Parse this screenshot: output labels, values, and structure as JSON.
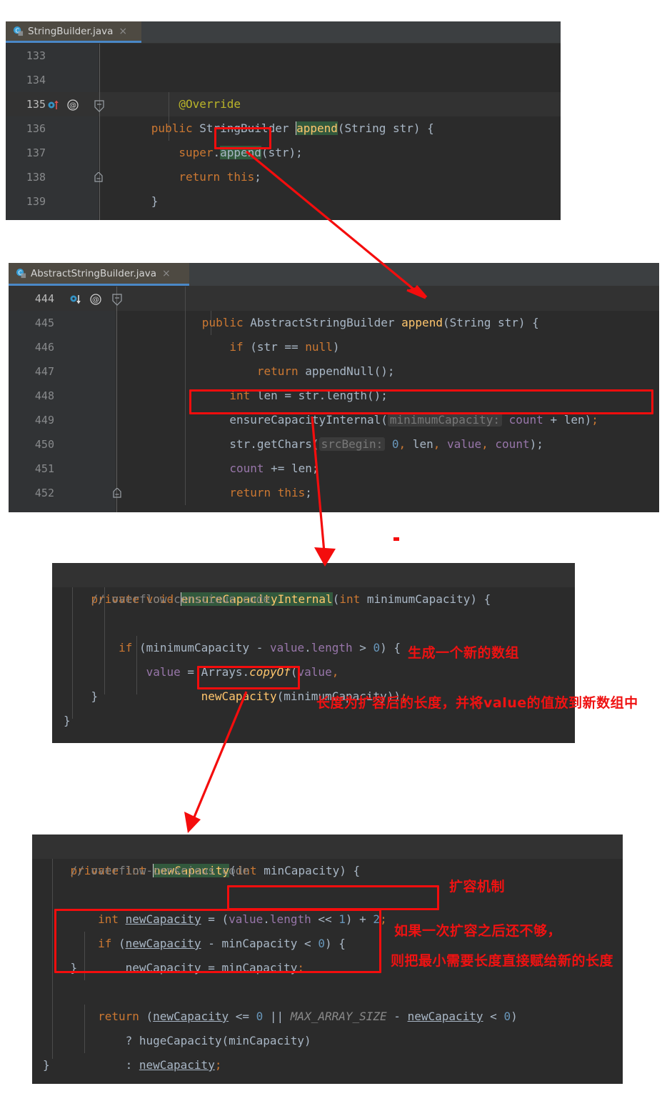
{
  "meta": {
    "accent_blue": "#4a88c7",
    "annotation_red": "#ef1212",
    "editor_bg": "#2b2b2b",
    "gutter_bg": "#313335",
    "tab_bg": "#4e4a42"
  },
  "panels": [
    {
      "id": "stringbuilder",
      "tab": {
        "label": "StringBuilder.java",
        "close": "×",
        "icon": "java-class-icon"
      },
      "lines": [
        {
          "num": "133",
          "text": ""
        },
        {
          "num": "134",
          "text": "    @Override"
        },
        {
          "num": "135",
          "text": "    public StringBuilder append(String str) {"
        },
        {
          "num": "136",
          "text": "        super.append(str);"
        },
        {
          "num": "137",
          "text": "        return this;"
        },
        {
          "num": "138",
          "text": "    }"
        },
        {
          "num": "139",
          "text": ""
        }
      ],
      "gutter_icons": {
        "line": "135",
        "override_marker": "overriding-method-icon",
        "at_marker": "annotation-icon",
        "fold": "fold-collapse-icon"
      }
    },
    {
      "id": "abstractstringbuilder",
      "tab": {
        "label": "AbstractStringBuilder.java",
        "close": "×",
        "icon": "java-class-icon"
      },
      "lines": [
        {
          "num": "444",
          "text": "    public AbstractStringBuilder append(String str) {"
        },
        {
          "num": "445",
          "text": "        if (str == null)"
        },
        {
          "num": "446",
          "text": "            return appendNull();"
        },
        {
          "num": "447",
          "text": "        int len = str.length();"
        },
        {
          "num": "448",
          "text": "        ensureCapacityInternal( minimumCapacity: count + len);"
        },
        {
          "num": "449",
          "text": "        str.getChars( srcBegin: 0, len, value, count);"
        },
        {
          "num": "450",
          "text": "        count += len;"
        },
        {
          "num": "451",
          "text": "        return this;"
        },
        {
          "num": "452",
          "text": "    }"
        }
      ],
      "param_hints": [
        "minimumCapacity:",
        "srcBegin:"
      ],
      "gutter_icons": {
        "line": "444",
        "implemented_marker": "implemented-method-icon",
        "at_marker": "annotation-icon",
        "fold": "fold-collapse-icon"
      }
    },
    {
      "id": "ensurecapacityinternal",
      "lines": [
        {
          "text": "private void ensureCapacityInternal(int minimumCapacity) {"
        },
        {
          "text": "    // overflow-conscious code"
        },
        {
          "text": "    if (minimumCapacity - value.length > 0) {"
        },
        {
          "text": "        value = Arrays.copyOf(value,"
        },
        {
          "text": "                newCapacity(minimumCapacity));"
        },
        {
          "text": "    }"
        },
        {
          "text": "}"
        }
      ]
    },
    {
      "id": "newcapacity",
      "lines": [
        {
          "text": "private int newCapacity(int minCapacity) {"
        },
        {
          "text": "    // overflow-conscious code"
        },
        {
          "text": "    int newCapacity = (value.length << 1) + 2;"
        },
        {
          "text": "    if (newCapacity - minCapacity < 0) {"
        },
        {
          "text": "        newCapacity = minCapacity;"
        },
        {
          "text": "    }"
        },
        {
          "text": "    return (newCapacity <= 0 || MAX_ARRAY_SIZE - newCapacity < 0)"
        },
        {
          "text": "        ? hugeCapacity(minCapacity)"
        },
        {
          "text": "        : newCapacity;"
        },
        {
          "text": "}"
        }
      ]
    }
  ],
  "annotations": [
    {
      "id": "note-new-array",
      "text": "生成一个新的数组"
    },
    {
      "id": "note-copy-value",
      "text": "长度为扩容后的长度，并将value的值放到新数组中"
    },
    {
      "id": "note-grow-mechanism",
      "text": "扩容机制"
    },
    {
      "id": "note-not-enough-1",
      "text": "如果一次扩容之后还不够，"
    },
    {
      "id": "note-not-enough-2",
      "text": "则把最小需要长度直接赋给新的长度"
    }
  ],
  "highlights": {
    "append_sb": "append",
    "append_asb": "append",
    "ensure_call": "ensureCapacityInternal( minimumCapacity: count + len);",
    "ensure_def": "ensureCapacityInternal",
    "newcap_call": "newCapacity",
    "newcap_def": "newCapacity",
    "grow_expr": "(value.length << 1) + 2;",
    "if_block": "if (newCapacity - minCapacity < 0) { newCapacity = minCapacity; }"
  }
}
